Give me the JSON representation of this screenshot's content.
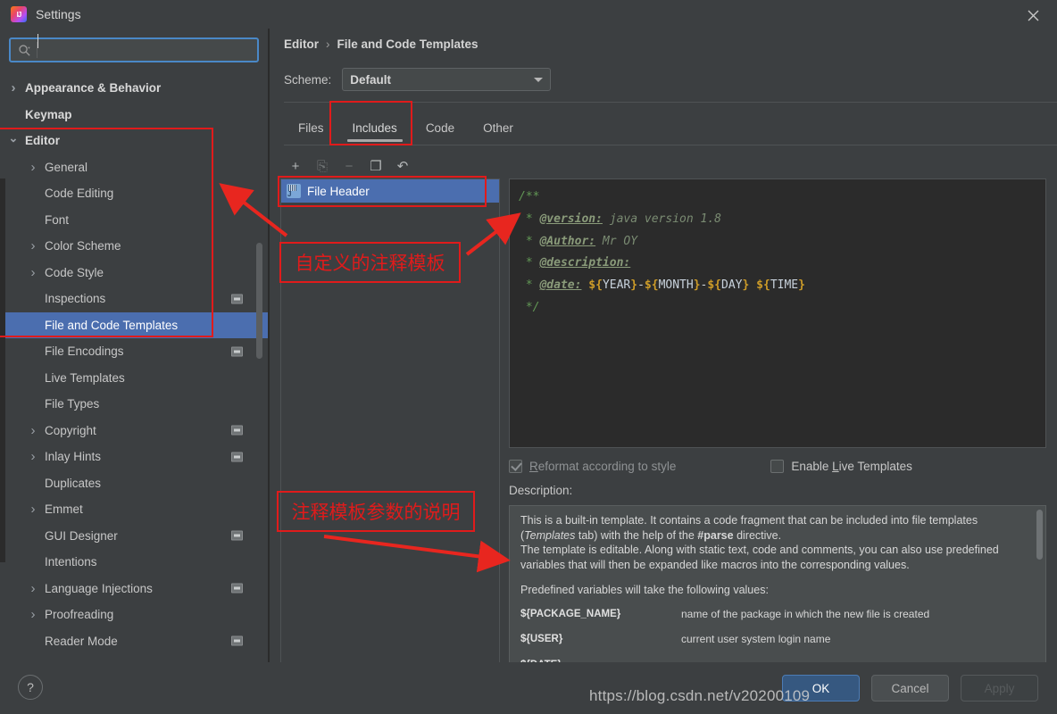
{
  "window": {
    "title": "Settings",
    "logo_icon": "intellij-idea-logo",
    "close_icon": "close-icon"
  },
  "sidebar": {
    "search": {
      "value": "",
      "placeholder": "",
      "icon": "search-icon"
    },
    "items": [
      {
        "label": "Appearance & Behavior",
        "level": 0,
        "arrow": "collapsed",
        "bold": true,
        "selected": false,
        "badge": false
      },
      {
        "label": "Keymap",
        "level": 0,
        "arrow": "none",
        "bold": true,
        "selected": false,
        "badge": false
      },
      {
        "label": "Editor",
        "level": 0,
        "arrow": "expanded",
        "bold": true,
        "selected": false,
        "badge": false
      },
      {
        "label": "General",
        "level": 1,
        "arrow": "collapsed",
        "bold": false,
        "selected": false,
        "badge": false
      },
      {
        "label": "Code Editing",
        "level": 1,
        "arrow": "none",
        "bold": false,
        "selected": false,
        "badge": false
      },
      {
        "label": "Font",
        "level": 1,
        "arrow": "none",
        "bold": false,
        "selected": false,
        "badge": false
      },
      {
        "label": "Color Scheme",
        "level": 1,
        "arrow": "collapsed",
        "bold": false,
        "selected": false,
        "badge": false
      },
      {
        "label": "Code Style",
        "level": 1,
        "arrow": "collapsed",
        "bold": false,
        "selected": false,
        "badge": false
      },
      {
        "label": "Inspections",
        "level": 1,
        "arrow": "none",
        "bold": false,
        "selected": false,
        "badge": true
      },
      {
        "label": "File and Code Templates",
        "level": 1,
        "arrow": "none",
        "bold": false,
        "selected": true,
        "badge": false
      },
      {
        "label": "File Encodings",
        "level": 1,
        "arrow": "none",
        "bold": false,
        "selected": false,
        "badge": true
      },
      {
        "label": "Live Templates",
        "level": 1,
        "arrow": "none",
        "bold": false,
        "selected": false,
        "badge": false
      },
      {
        "label": "File Types",
        "level": 1,
        "arrow": "none",
        "bold": false,
        "selected": false,
        "badge": false
      },
      {
        "label": "Copyright",
        "level": 1,
        "arrow": "collapsed",
        "bold": false,
        "selected": false,
        "badge": true
      },
      {
        "label": "Inlay Hints",
        "level": 1,
        "arrow": "collapsed",
        "bold": false,
        "selected": false,
        "badge": true
      },
      {
        "label": "Duplicates",
        "level": 1,
        "arrow": "none",
        "bold": false,
        "selected": false,
        "badge": false
      },
      {
        "label": "Emmet",
        "level": 1,
        "arrow": "collapsed",
        "bold": false,
        "selected": false,
        "badge": false
      },
      {
        "label": "GUI Designer",
        "level": 1,
        "arrow": "none",
        "bold": false,
        "selected": false,
        "badge": true
      },
      {
        "label": "Intentions",
        "level": 1,
        "arrow": "none",
        "bold": false,
        "selected": false,
        "badge": false
      },
      {
        "label": "Language Injections",
        "level": 1,
        "arrow": "collapsed",
        "bold": false,
        "selected": false,
        "badge": true
      },
      {
        "label": "Proofreading",
        "level": 1,
        "arrow": "collapsed",
        "bold": false,
        "selected": false,
        "badge": false
      },
      {
        "label": "Reader Mode",
        "level": 1,
        "arrow": "none",
        "bold": false,
        "selected": false,
        "badge": true
      }
    ]
  },
  "main": {
    "breadcrumb": {
      "parent": "Editor",
      "separator": "›",
      "current": "File and Code Templates"
    },
    "scheme": {
      "label": "Scheme:",
      "value": "Default"
    },
    "tabs": [
      {
        "label": "Files",
        "active": false
      },
      {
        "label": "Includes",
        "active": true
      },
      {
        "label": "Code",
        "active": false
      },
      {
        "label": "Other",
        "active": false
      }
    ],
    "list_toolbar": [
      {
        "icon": "plus-icon",
        "label": "+",
        "enabled": true
      },
      {
        "icon": "copy-template-icon",
        "label": "⎘",
        "enabled": false
      },
      {
        "icon": "minus-icon",
        "label": "−",
        "enabled": false
      },
      {
        "icon": "duplicate-icon",
        "label": "❐",
        "enabled": true
      },
      {
        "icon": "reset-icon",
        "label": "↶",
        "enabled": true
      }
    ],
    "templates": [
      {
        "label": "File Header",
        "selected": true,
        "icon": "java-template-icon"
      }
    ],
    "editor": {
      "lines": [
        {
          "parts": [
            {
              "t": "/**",
              "c": "cm"
            }
          ]
        },
        {
          "parts": [
            {
              "t": " * ",
              "c": "cm"
            },
            {
              "t": "@version:",
              "c": "cm-tag"
            },
            {
              "t": " java version 1.8",
              "c": "cm-txt"
            }
          ]
        },
        {
          "parts": [
            {
              "t": " * ",
              "c": "cm"
            },
            {
              "t": "@Author:",
              "c": "cm-tag"
            },
            {
              "t": " Mr OY",
              "c": "cm-txt"
            }
          ]
        },
        {
          "parts": [
            {
              "t": " * ",
              "c": "cm"
            },
            {
              "t": "@description:",
              "c": "cm-tag"
            }
          ]
        },
        {
          "parts": [
            {
              "t": " * ",
              "c": "cm"
            },
            {
              "t": "@date:",
              "c": "cm-tag"
            },
            {
              "t": " ",
              "c": "cm-txt"
            },
            {
              "t": "${",
              "c": "var-brace"
            },
            {
              "t": "YEAR",
              "c": "var-name"
            },
            {
              "t": "}",
              "c": "var-brace"
            },
            {
              "t": "-",
              "c": "dash"
            },
            {
              "t": "${",
              "c": "var-brace"
            },
            {
              "t": "MONTH",
              "c": "var-name"
            },
            {
              "t": "}",
              "c": "var-brace"
            },
            {
              "t": "-",
              "c": "dash"
            },
            {
              "t": "${",
              "c": "var-brace"
            },
            {
              "t": "DAY",
              "c": "var-name"
            },
            {
              "t": "}",
              "c": "var-brace"
            },
            {
              "t": " ",
              "c": "dash"
            },
            {
              "t": "${",
              "c": "var-brace"
            },
            {
              "t": "TIME",
              "c": "var-name"
            },
            {
              "t": "}",
              "c": "var-brace"
            }
          ]
        },
        {
          "parts": [
            {
              "t": " */",
              "c": "cm"
            }
          ]
        }
      ]
    },
    "checkboxes": [
      {
        "label": "Reformat according to style",
        "checked": true,
        "disabled": true,
        "mnemonic": "R"
      },
      {
        "label": "Enable Live Templates",
        "checked": false,
        "disabled": false,
        "mnemonic": "L"
      }
    ],
    "description": {
      "label": "Description:",
      "paragraph1_a": "This is a built-in template. It contains a code fragment that can be included into file templates (",
      "paragraph1_italic": "Templates",
      "paragraph1_b": " tab) with the help of the ",
      "paragraph1_bold": "#parse",
      "paragraph1_c": " directive.",
      "paragraph2": "The template is editable. Along with static text, code and comments, you can also use predefined variables that will then be expanded like macros into the corresponding values.",
      "paragraph3": "Predefined variables will take the following values:",
      "variables": [
        {
          "name": "${PACKAGE_NAME}",
          "desc": "name of the package in which the new file is created"
        },
        {
          "name": "${USER}",
          "desc": "current user system login name"
        },
        {
          "name": "${DATE}",
          "desc": ""
        }
      ]
    }
  },
  "footer": {
    "help_icon": "help-question-icon",
    "ok": "OK",
    "cancel": "Cancel",
    "apply": "Apply"
  },
  "annotations": {
    "note_template": "自定义的注释模板",
    "note_params": "注释模板参数的说明",
    "color": "#e01b1b"
  },
  "watermark": "https://blog.csdn.net/v20200109"
}
